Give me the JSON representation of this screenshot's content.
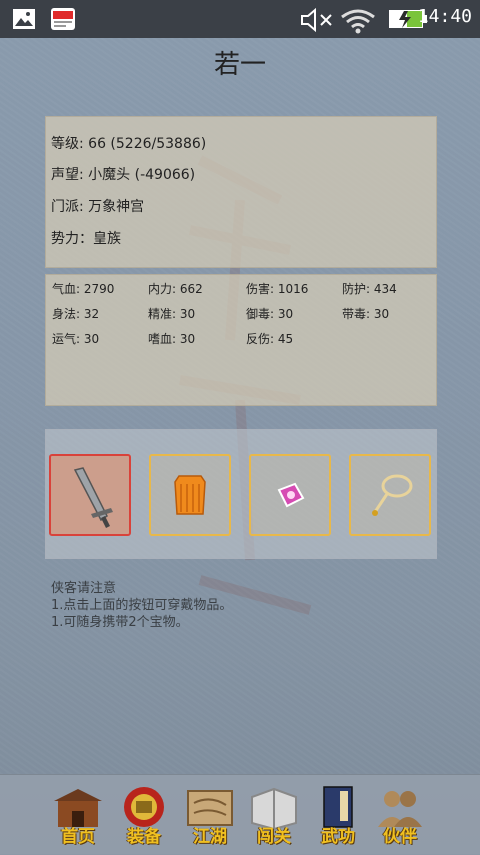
{
  "status_bar": {
    "time": "14:40"
  },
  "title": "若一",
  "info": [
    {
      "label": "等级: 66 (5226/53886)"
    },
    {
      "label": "声望: 小魔头 (-49066)"
    },
    {
      "label": "门派: 万象神宫"
    },
    {
      "label": "势力：皇族"
    }
  ],
  "stats": [
    [
      "气血: 2790",
      "内力: 662",
      "伤害: 1016",
      "防护: 434"
    ],
    [
      "身法: 32",
      "精准: 30",
      "御毒: 30",
      "带毒: 30"
    ],
    [
      "运气: 30",
      "嗜血: 30",
      "反伤: 45",
      ""
    ]
  ],
  "equipment_slots": [
    {
      "icon": "sword-icon",
      "active": true
    },
    {
      "icon": "armor-icon",
      "active": false
    },
    {
      "icon": "gem-icon",
      "active": false
    },
    {
      "icon": "necklace-icon",
      "active": false
    }
  ],
  "notice": {
    "title": "侠客请注意",
    "line1": "1.点击上面的按钮可穿戴物品。",
    "line2": "1.可随身携带2个宝物。"
  },
  "nav": [
    {
      "label": "首页",
      "icon": "house-icon"
    },
    {
      "label": "装备",
      "icon": "equipment-icon"
    },
    {
      "label": "江湖",
      "icon": "scroll-icon"
    },
    {
      "label": "闯关",
      "icon": "book-icon"
    },
    {
      "label": "武功",
      "icon": "manual-icon"
    },
    {
      "label": "伙伴",
      "icon": "partner-icon"
    }
  ],
  "colors": {
    "accent": "#f0c020",
    "slot_border": "#e8b84a",
    "active_border": "#d9423a"
  }
}
